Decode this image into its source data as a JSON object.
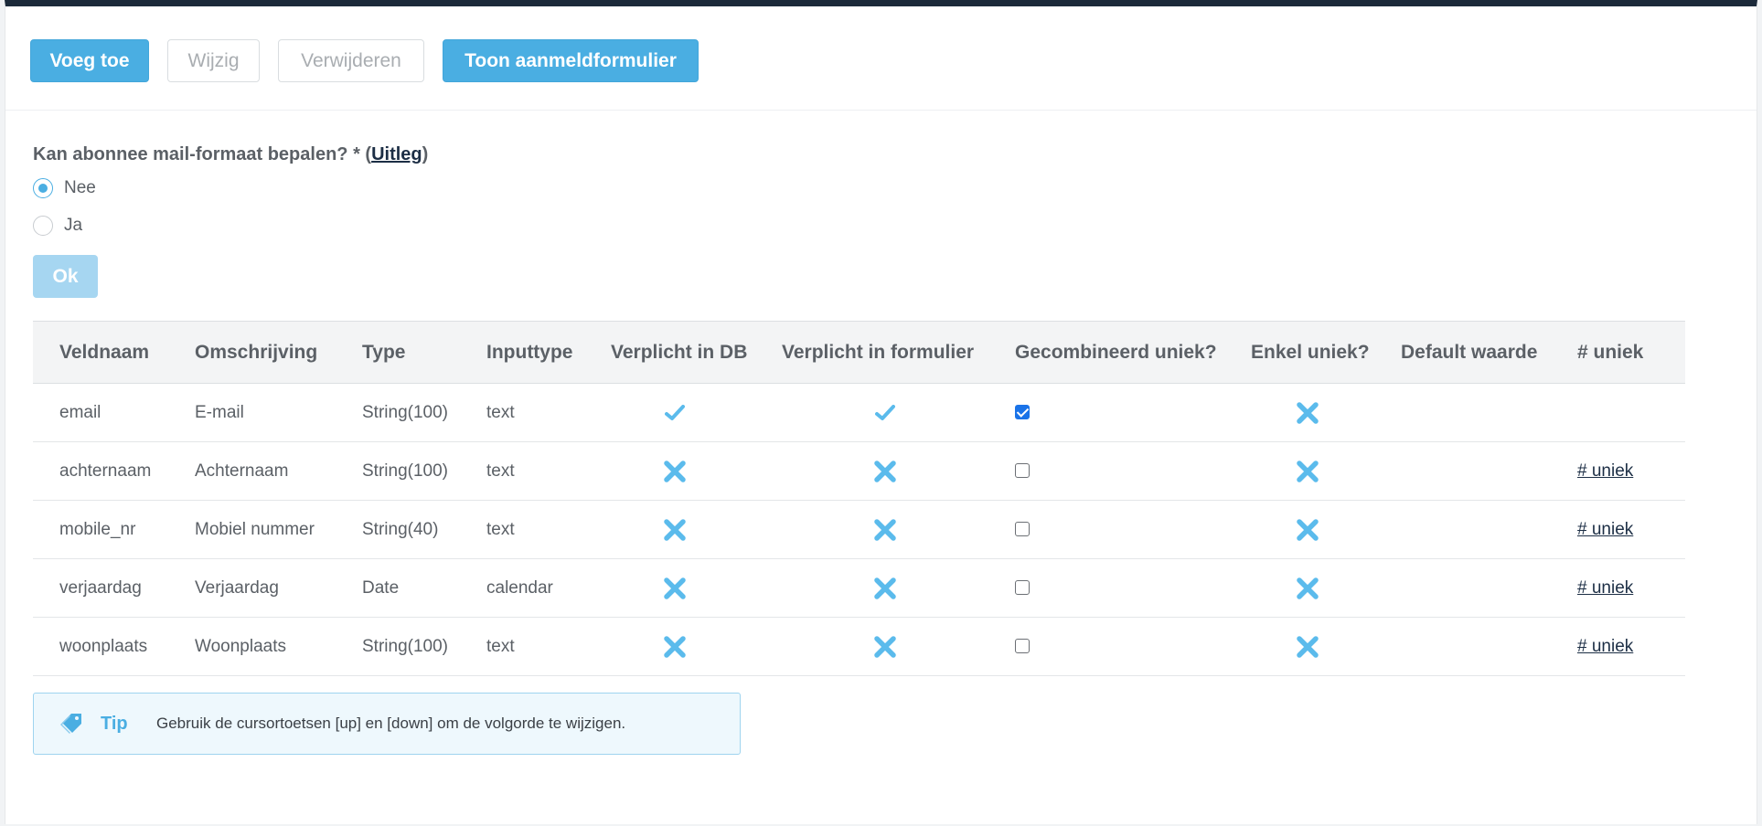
{
  "toolbar": {
    "add_label": "Voeg toe",
    "edit_label": "Wijzig",
    "delete_label": "Verwijderen",
    "show_form_label": "Toon aanmeldformulier"
  },
  "mail_format": {
    "question": "Kan abonnee mail-formaat bepalen? * (",
    "link_label": "Uitleg",
    "question_end": ")",
    "options": [
      {
        "label": "Nee",
        "selected": true
      },
      {
        "label": "Ja",
        "selected": false
      }
    ],
    "ok_label": "Ok"
  },
  "table": {
    "headers": [
      "Veldnaam",
      "Omschrijving",
      "Type",
      "Inputtype",
      "Verplicht in DB",
      "Verplicht in formulier",
      "Gecombineerd uniek?",
      "Enkel uniek?",
      "Default waarde",
      "# uniek"
    ],
    "rows": [
      {
        "name": "email",
        "description": "E-mail",
        "type": "String(100)",
        "input": "text",
        "required_db": true,
        "required_form": true,
        "combined_unique": true,
        "single_unique": false,
        "default": "",
        "count_link": ""
      },
      {
        "name": "achternaam",
        "description": "Achternaam",
        "type": "String(100)",
        "input": "text",
        "required_db": false,
        "required_form": false,
        "combined_unique": false,
        "single_unique": false,
        "default": "",
        "count_link": "# uniek"
      },
      {
        "name": "mobile_nr",
        "description": "Mobiel nummer",
        "type": "String(40)",
        "input": "text",
        "required_db": false,
        "required_form": false,
        "combined_unique": false,
        "single_unique": false,
        "default": "",
        "count_link": "# uniek"
      },
      {
        "name": "verjaardag",
        "description": "Verjaardag",
        "type": "Date",
        "input": "calendar",
        "required_db": false,
        "required_form": false,
        "combined_unique": false,
        "single_unique": false,
        "default": "",
        "count_link": "# uniek"
      },
      {
        "name": "woonplaats",
        "description": "Woonplaats",
        "type": "String(100)",
        "input": "text",
        "required_db": false,
        "required_form": false,
        "combined_unique": false,
        "single_unique": false,
        "default": "",
        "count_link": "# uniek"
      }
    ]
  },
  "tip": {
    "label": "Tip",
    "text": "Gebruik de cursortoetsen [up] en [down] om de volgorde te wijzigen."
  },
  "icons": {
    "check": "check-icon",
    "cross": "cross-icon",
    "tag": "tag-icon"
  },
  "colors": {
    "accent": "#4aaee2",
    "header_bar": "#1c2a3a",
    "tip_bg": "#eef8fd"
  }
}
